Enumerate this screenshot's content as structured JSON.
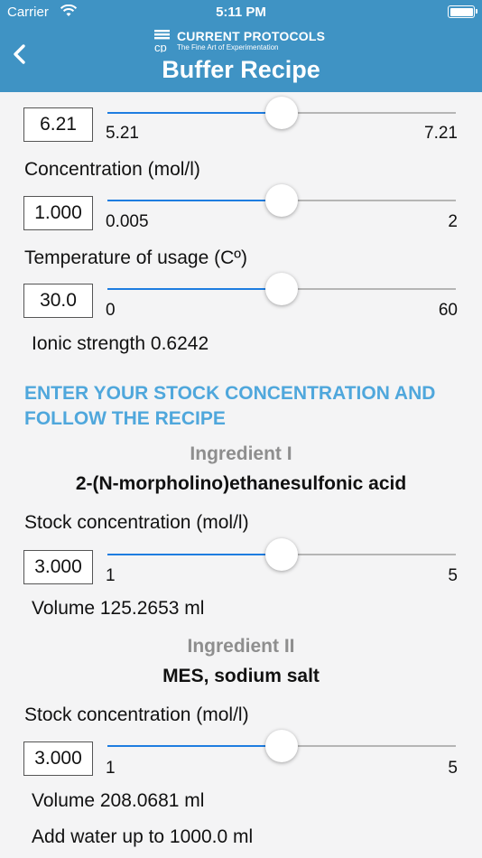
{
  "status_bar": {
    "carrier": "Carrier",
    "time": "5:11 PM"
  },
  "header": {
    "logo_title": "CURRENT PROTOCOLS",
    "logo_tagline": "The Fine Art of Experimentation",
    "title": "Buffer Recipe"
  },
  "ph": {
    "value": "6.21",
    "min": "5.21",
    "max": "7.21",
    "fraction": 0.5
  },
  "concentration": {
    "label": "Concentration (mol/l)",
    "value": "1.000",
    "min": "0.005",
    "max": "2",
    "fraction": 0.5
  },
  "temperature": {
    "label": "Temperature of usage (Cº)",
    "value": "30.0",
    "min": "0",
    "max": "60",
    "fraction": 0.5
  },
  "ionic_strength": "Ionic strength 0.6242",
  "stock_section_title": "ENTER YOUR STOCK CONCENTRATION AND FOLLOW THE RECIPE",
  "ingredients": [
    {
      "heading": "Ingredient I",
      "name": "2-(N-morpholino)ethanesulfonic acid",
      "stock_label": "Stock concentration (mol/l)",
      "value": "3.000",
      "min": "1",
      "max": "5",
      "fraction": 0.5,
      "volume": "Volume 125.2653 ml"
    },
    {
      "heading": "Ingredient II",
      "name": "MES, sodium salt",
      "stock_label": "Stock concentration (mol/l)",
      "value": "3.000",
      "min": "1",
      "max": "5",
      "fraction": 0.5,
      "volume": "Volume 208.0681 ml"
    }
  ],
  "water_note": "Add water up to 1000.0 ml",
  "colors": {
    "header": "#3f93c4",
    "accent": "#4fa7dc",
    "slider_fill": "#1e7de0",
    "slider_track": "#b5b5b5",
    "heading_gray": "#8e8e8e"
  },
  "icons": {
    "back": "chevron-left-icon",
    "wifi": "wifi-icon",
    "battery": "battery-icon",
    "logo": "current-protocols-logo"
  }
}
